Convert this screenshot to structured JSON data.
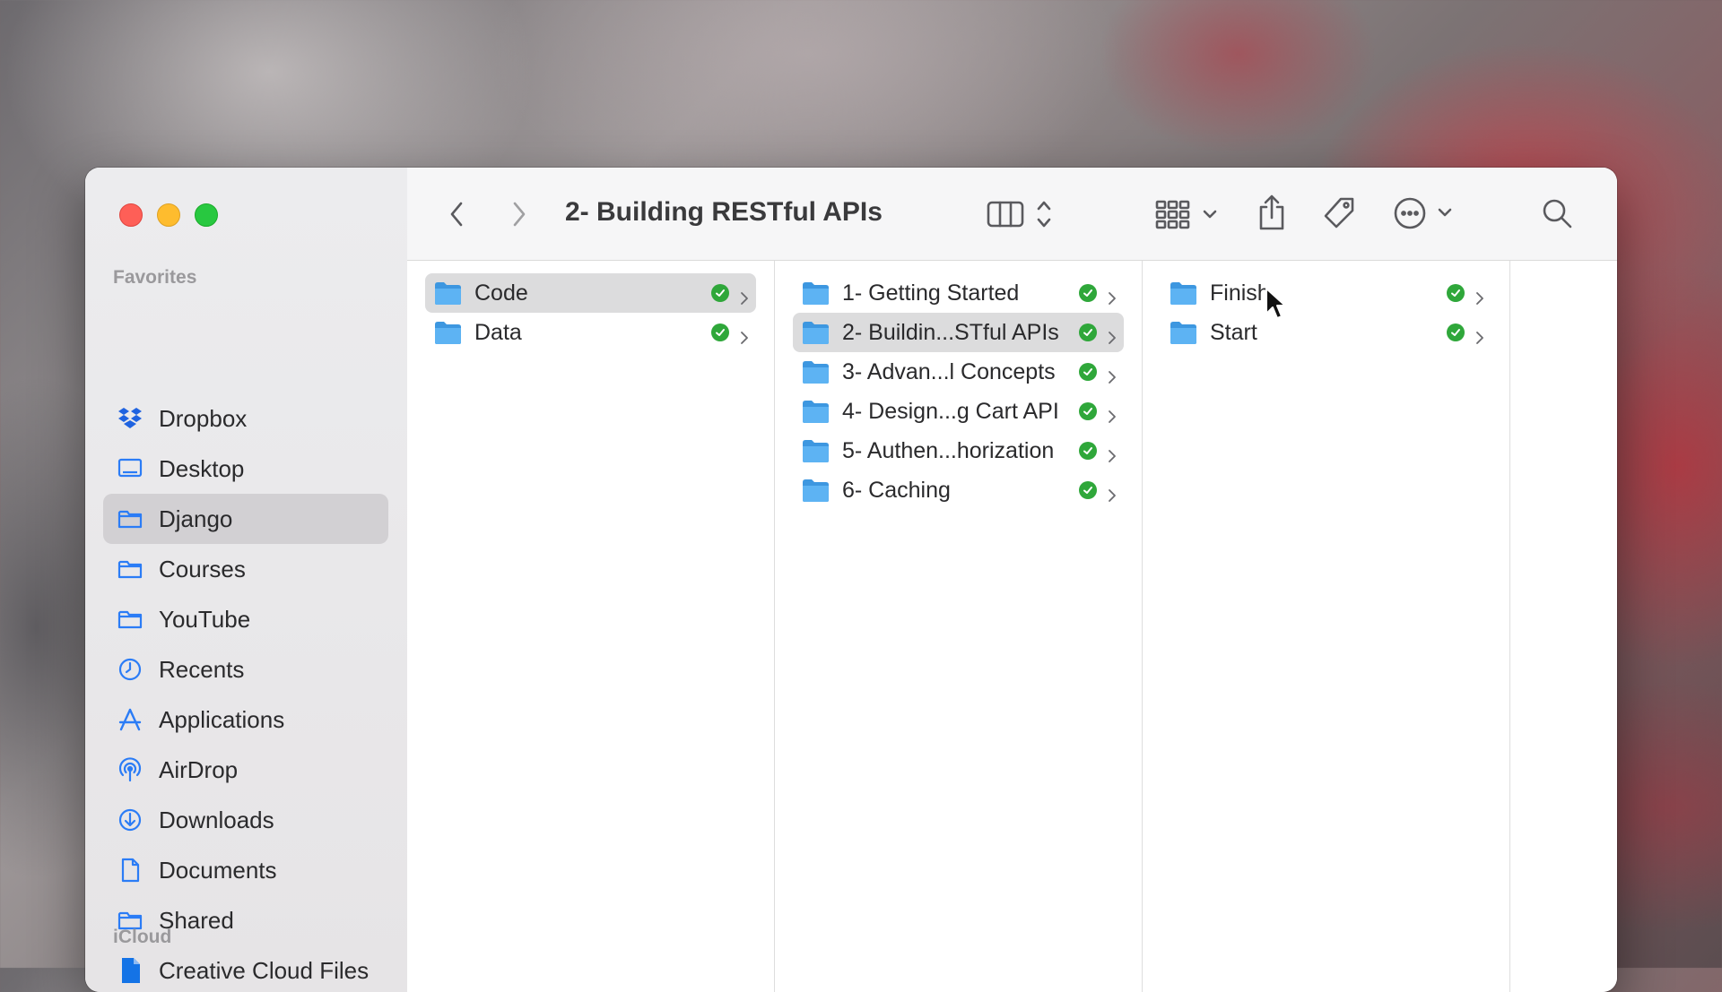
{
  "window": {
    "title": "2- Building RESTful APIs"
  },
  "sidebar": {
    "favorites_label": "Favorites",
    "icloud_label": "iCloud",
    "items": [
      {
        "label": "Dropbox",
        "icon": "dropbox-icon"
      },
      {
        "label": "Desktop",
        "icon": "desktop-icon"
      },
      {
        "label": "Django",
        "icon": "folder-icon",
        "selected": true
      },
      {
        "label": "Courses",
        "icon": "folder-icon"
      },
      {
        "label": "YouTube",
        "icon": "folder-icon"
      },
      {
        "label": "Recents",
        "icon": "clock-icon"
      },
      {
        "label": "Applications",
        "icon": "applications-icon"
      },
      {
        "label": "AirDrop",
        "icon": "airdrop-icon"
      },
      {
        "label": "Downloads",
        "icon": "downloads-icon"
      },
      {
        "label": "Documents",
        "icon": "document-icon"
      },
      {
        "label": "Shared",
        "icon": "folder-icon"
      },
      {
        "label": "Creative Cloud Files",
        "icon": "creative-cloud-file-icon"
      }
    ]
  },
  "toolbar": {
    "back": "chevron-left-icon",
    "forward": "chevron-right-icon",
    "view": "columns-view-icon",
    "group": "grid-group-icon",
    "share": "share-icon",
    "tags": "tag-icon",
    "more": "ellipsis-icon",
    "search": "search-icon"
  },
  "columns": [
    {
      "items": [
        {
          "name": "Code",
          "selected": true
        },
        {
          "name": "Data",
          "selected": false
        }
      ]
    },
    {
      "items": [
        {
          "name": "1- Getting Started",
          "selected": false
        },
        {
          "name": "2- Buildin...STful APIs",
          "selected": true
        },
        {
          "name": "3- Advan...l Concepts",
          "selected": false
        },
        {
          "name": "4- Design...g Cart API",
          "selected": false
        },
        {
          "name": "5- Authen...horization",
          "selected": false
        },
        {
          "name": "6- Caching",
          "selected": false
        }
      ]
    },
    {
      "items": [
        {
          "name": "Finish",
          "selected": false
        },
        {
          "name": "Start",
          "selected": false
        }
      ]
    }
  ],
  "colors": {
    "accent": "#2b7cf6",
    "folder": "#4aa8f0",
    "sync_ok": "#2fa73a"
  }
}
